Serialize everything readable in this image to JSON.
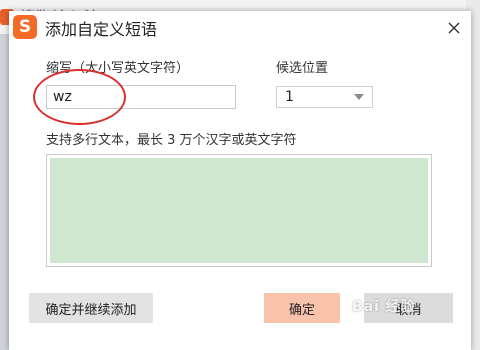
{
  "background": {
    "partial_title": "搜狗输入法"
  },
  "dialog": {
    "title": "添加自定义短语",
    "code_label": "缩写（大小写英文字符）",
    "code_value": "wz",
    "position_label": "候选位置",
    "position_value": "1",
    "content_hint": "支持多行文本，最长 3 万个汉字或英文字符",
    "content_value": "",
    "buttons": {
      "continue": "确定并继续添加",
      "ok": "确定",
      "cancel": "取消"
    }
  },
  "watermark": "Bai 经验",
  "colors": {
    "accent": "#f46a27",
    "ok_button": "#f8c2ab",
    "text_area_fill": "#cfe7d0",
    "annotation_circle": "#d9302f"
  }
}
